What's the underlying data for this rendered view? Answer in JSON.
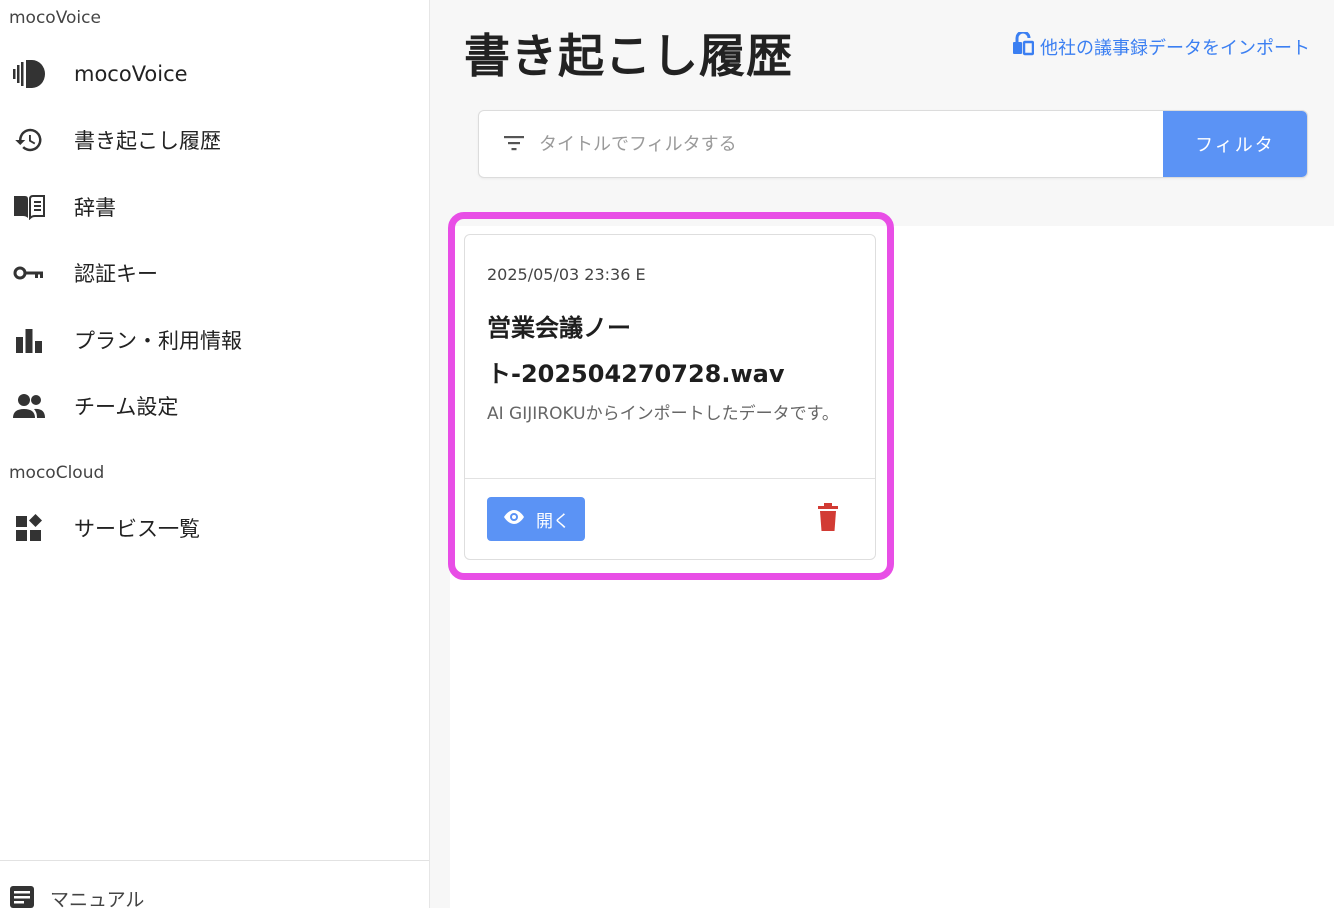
{
  "sidebar": {
    "section_voice": "mocoVoice",
    "section_cloud": "mocoCloud",
    "items": [
      {
        "label": "mocoVoice",
        "icon": "wave-logo-icon"
      },
      {
        "label": "書き起こし履歴",
        "icon": "history-icon"
      },
      {
        "label": "辞書",
        "icon": "book-icon"
      },
      {
        "label": "認証キー",
        "icon": "key-icon"
      },
      {
        "label": "プラン・利用情報",
        "icon": "bar-chart-icon"
      },
      {
        "label": "チーム設定",
        "icon": "people-icon"
      },
      {
        "label": "サービス一覧",
        "icon": "widgets-icon"
      }
    ],
    "footer": {
      "label": "マニュアル",
      "icon": "article-icon"
    }
  },
  "main": {
    "title": "書き起こし履歴",
    "import_link": "他社の議事録データをインポート",
    "filter": {
      "placeholder": "タイトルでフィルタする",
      "value": "",
      "button_label": "フィルタ"
    },
    "cards": [
      {
        "date": "2025/05/03 23:36 E",
        "title": "営業会議ノート-202504270728.wav",
        "description": "AI GIJIROKUからインポートしたデータです。",
        "open_label": "開く"
      }
    ]
  },
  "colors": {
    "accent": "#5b93f5",
    "link": "#3b7ff2",
    "delete": "#d23b34",
    "highlight": "#e84ee6"
  }
}
